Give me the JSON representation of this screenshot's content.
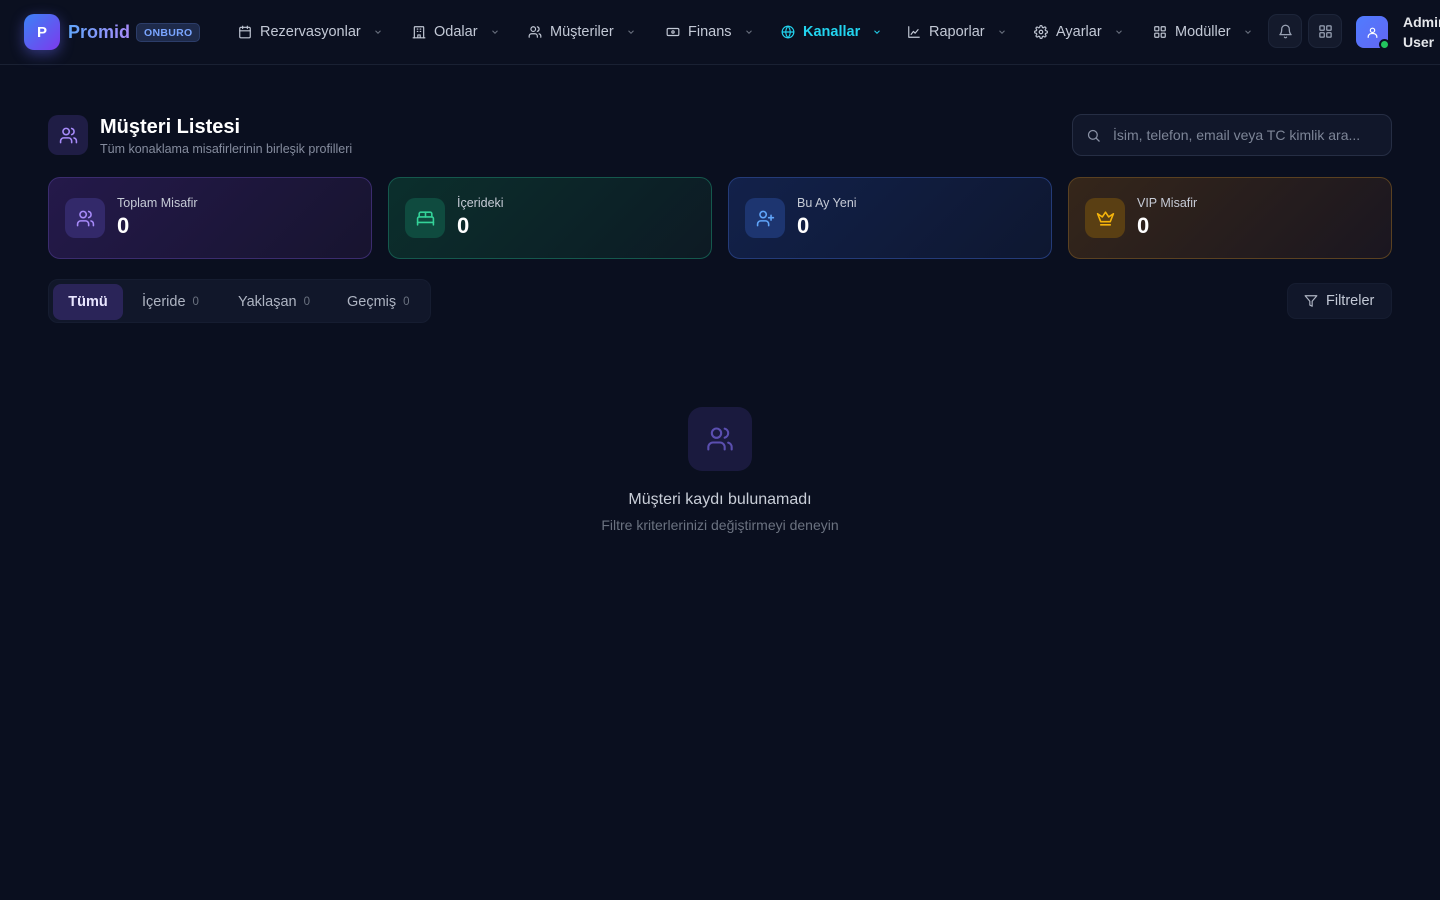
{
  "brand": {
    "logo_letter": "P",
    "name": "Promid",
    "badge": "ONBURO",
    "accent": "#3b82f6"
  },
  "nav": [
    {
      "label": "Rezervasyonlar",
      "icon": "calendar-icon"
    },
    {
      "label": "Odalar",
      "icon": "building-icon"
    },
    {
      "label": "Müşteriler",
      "icon": "users-icon"
    },
    {
      "label": "Finans",
      "icon": "banknote-icon"
    },
    {
      "label": "Kanallar",
      "icon": "globe-icon",
      "active": true
    },
    {
      "label": "Raporlar",
      "icon": "chart-icon"
    },
    {
      "label": "Ayarlar",
      "icon": "gear-icon"
    },
    {
      "label": "Modüller",
      "icon": "grid-icon"
    }
  ],
  "user": {
    "name": "Admin User",
    "status_color": "#22c55e"
  },
  "header": {
    "title": "Müşteri Listesi",
    "subtitle": "Tüm konaklama misafirlerinin birleşik profilleri"
  },
  "search": {
    "placeholder": "İsim, telefon, email veya TC kimlik ara...",
    "value": ""
  },
  "stats": [
    {
      "label": "Toplam Misafir",
      "value": "0",
      "icon": "users-icon",
      "color": "#a78bfa"
    },
    {
      "label": "İçerideki",
      "value": "0",
      "icon": "bed-icon",
      "color": "#34d399"
    },
    {
      "label": "Bu Ay Yeni",
      "value": "0",
      "icon": "user-plus-icon",
      "color": "#60a5fa"
    },
    {
      "label": "VIP Misafir",
      "value": "0",
      "icon": "crown-icon",
      "color": "#f5b40b"
    }
  ],
  "tabs": [
    {
      "label": "Tümü",
      "active": true
    },
    {
      "label": "İçeride",
      "count": "0"
    },
    {
      "label": "Yaklaşan",
      "count": "0"
    },
    {
      "label": "Geçmiş",
      "count": "0"
    }
  ],
  "filter": {
    "label": "Filtreler"
  },
  "empty": {
    "title": "Müşteri kaydı bulunamadı",
    "subtitle": "Filtre kriterlerinizi değiştirmeyi deneyin"
  }
}
